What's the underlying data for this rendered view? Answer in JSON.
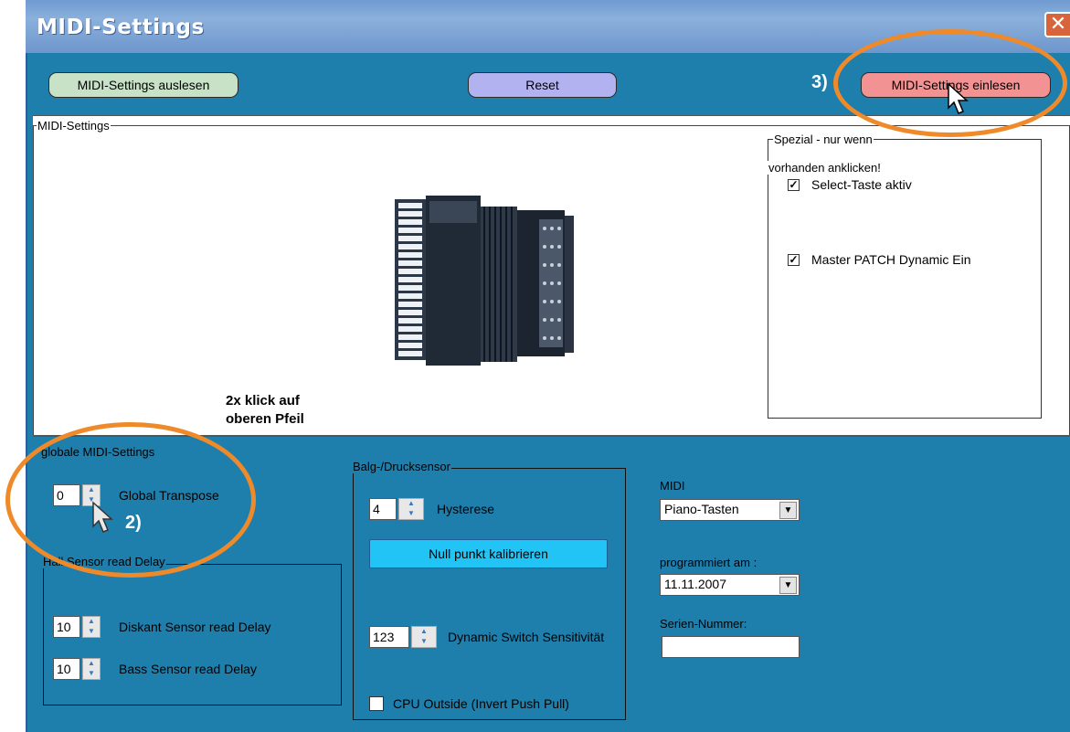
{
  "window": {
    "title": "MIDI-Settings",
    "close_glyph": "✕"
  },
  "toolbar": {
    "read_label": "MIDI-Settings auslesen",
    "reset_label": "Reset",
    "load_label": "MIDI-Settings einlesen",
    "step3_marker": "3)"
  },
  "midi_settings": {
    "legend": "MIDI-Settings",
    "image": "accordion",
    "special": {
      "legend_line1": "Spezial - nur wenn",
      "legend_line2": "vorhanden anklicken!",
      "select_label": "Select-Taste aktiv",
      "select_checked": true,
      "master_label": "Master PATCH Dynamic Ein",
      "master_checked": true
    },
    "hint_line1": "2x klick auf",
    "hint_line2": "oberen Pfeil"
  },
  "global": {
    "legend": "globale MIDI-Settings",
    "transpose_value": "0",
    "transpose_label": "Global Transpose",
    "step2_marker": "2)"
  },
  "hall": {
    "legend": "Hall Sensor read Delay",
    "diskant_value": "10",
    "diskant_label": "Diskant Sensor read Delay",
    "bass_value": "10",
    "bass_label": "Bass Sensor read Delay"
  },
  "balg": {
    "legend": "Balg-/Drucksensor",
    "hysterese_value": "4",
    "hysterese_label": "Hysterese",
    "null_button": "Null punkt kalibrieren",
    "dynamic_value": "123",
    "dynamic_label": "Dynamic Switch Sensitivität",
    "cpu_label": "CPU Outside (Invert Push Pull)",
    "cpu_checked": false
  },
  "midi_panel": {
    "midi_label": "MIDI",
    "midi_value": "Piano-Tasten",
    "programmed_label": "programmiert am :",
    "programmed_value": "11.11.2007",
    "serial_label": "Serien-Nummer:",
    "serial_value": ""
  },
  "colors": {
    "window_bg": "#1e7fad",
    "highlight_ring": "#ef8a2a"
  }
}
